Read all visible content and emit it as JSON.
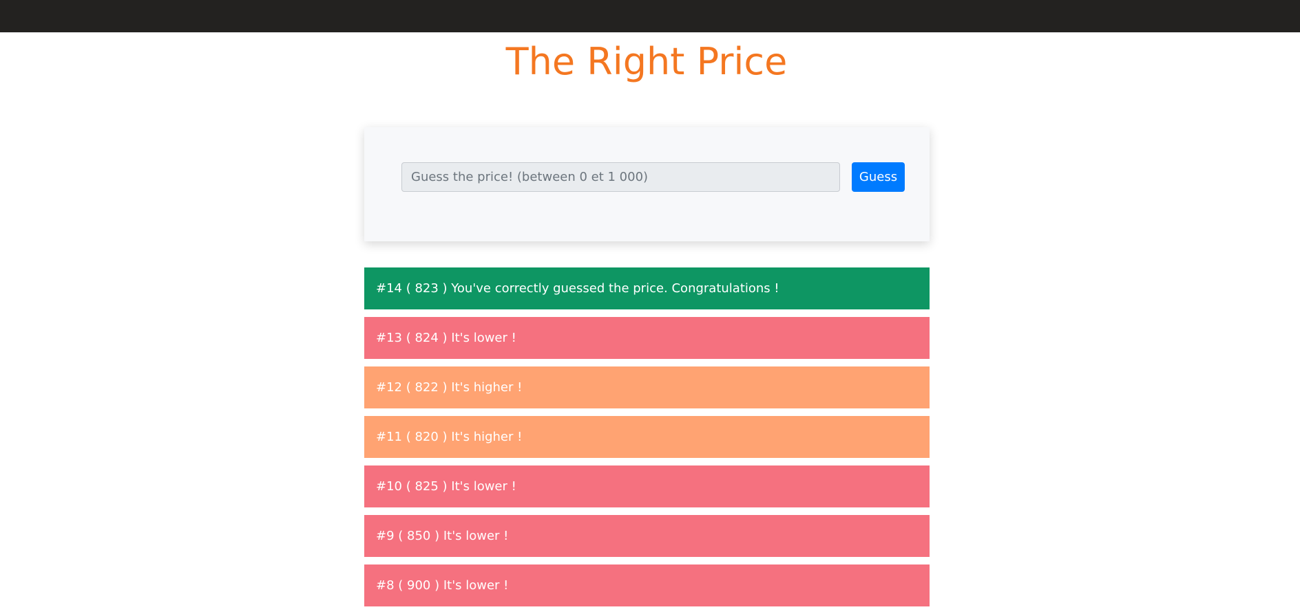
{
  "page": {
    "title": "The Right Price"
  },
  "form": {
    "input_value": "",
    "input_placeholder": "Guess the price! (between 0 et 1 000)",
    "button_label": "Guess"
  },
  "colors": {
    "topbar": "#232220",
    "title": "#f47721",
    "correct": "#0e9663",
    "lower": "#f5717f",
    "higher": "#ffa372",
    "button": "#007bff"
  },
  "results": [
    {
      "text": "#14 ( 823 ) You've correctly guessed the price. Congratulations !",
      "status": "correct"
    },
    {
      "text": "#13 ( 824 ) It's lower !",
      "status": "lower"
    },
    {
      "text": "#12 ( 822 ) It's higher !",
      "status": "higher"
    },
    {
      "text": "#11 ( 820 ) It's higher !",
      "status": "higher"
    },
    {
      "text": "#10 ( 825 ) It's lower !",
      "status": "lower"
    },
    {
      "text": "#9 ( 850 ) It's lower !",
      "status": "lower"
    },
    {
      "text": "#8 ( 900 ) It's lower !",
      "status": "lower"
    }
  ]
}
